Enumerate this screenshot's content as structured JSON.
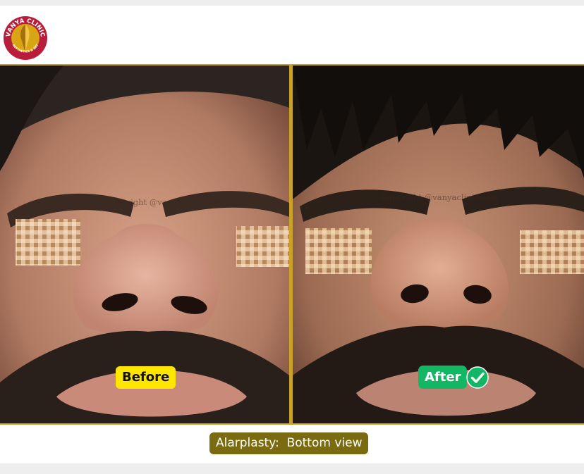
{
  "brand": {
    "name": "VANYA CLINIC",
    "tagline": "AESTHETICS & ART",
    "colors": {
      "ring": "#b81e3c",
      "inner": "#d9a514"
    }
  },
  "before_panel": {
    "label": "Before",
    "watermark": "Copyright @vanyaclinic.com"
  },
  "after_panel": {
    "label": "After",
    "watermark": "Copyright @vanyaclinic.com",
    "badge_icon": "check-circle-icon"
  },
  "caption": "Alarplasty:  Bottom view",
  "colors": {
    "before_badge": "#ffe600",
    "after_badge": "#12b765",
    "caption_bg": "#7a6a10",
    "frame": "#c9a227"
  }
}
